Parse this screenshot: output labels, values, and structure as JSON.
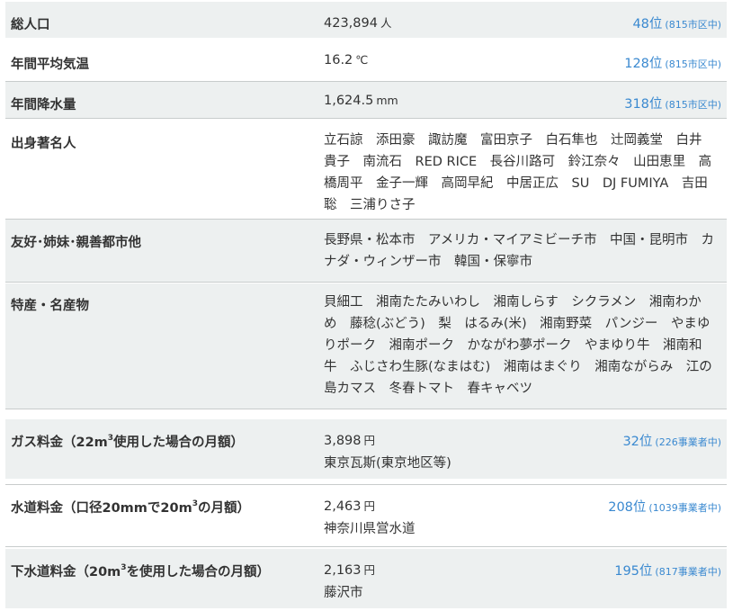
{
  "rows": {
    "population": {
      "label": "総人口",
      "value": "423,894",
      "unit": "人",
      "rank": "48位",
      "of": "(815市区中)"
    },
    "temperature": {
      "label": "年間平均気温",
      "value": "16.2",
      "unit": "℃",
      "rank": "128位",
      "of": "(815市区中)"
    },
    "rainfall": {
      "label": "年間降水量",
      "value": "1,624.5",
      "unit": "mm",
      "rank": "318位",
      "of": "(815市区中)"
    },
    "celebrities": {
      "label": "出身著名人",
      "text": "立石諒　添田豪　諏訪魔　富田京子　白石隼也　辻岡義堂　白井貴子　南流石　RED RICE　長谷川路可　鈴江奈々　山田恵里　高橋周平　金子一輝　高岡早紀　中居正広　SU　DJ FUMIYA　吉田聡　三浦りさ子"
    },
    "sister_cities": {
      "label": "友好･姉妹･親善都市他",
      "text": "長野県・松本市　アメリカ・マイアミビーチ市　中国・昆明市　カナダ・ウィンザー市　韓国・保寧市"
    },
    "specialties": {
      "label": "特産・名産物",
      "text": "貝細工　湘南たたみいわし　湘南しらす　シクラメン　湘南わかめ　藤稔(ぶどう)　梨　はるみ(米)　湘南野菜　パンジー　やまゆりポーク　湘南ポーク　かながわ夢ポーク　やまゆり牛　湘南和牛　ふじさわ生豚(なまはむ)　湘南はまぐり　湘南ながらみ　江の島カマス　冬春トマト　春キャベツ"
    },
    "gas": {
      "label_a": "ガス料金（22m",
      "label_sup": "3",
      "label_b": "使用した場合の月額）",
      "value": "3,898",
      "unit": "円",
      "provider": "東京瓦斯(東京地区等)",
      "rank": "32位",
      "of": "(226事業者中)"
    },
    "water": {
      "label_a": "水道料金（口径20mmで20m",
      "label_sup": "3",
      "label_b": "の月額）",
      "value": "2,463",
      "unit": "円",
      "provider": "神奈川県営水道",
      "rank": "208位",
      "of": "(1039事業者中)"
    },
    "sewer": {
      "label_a": "下水道料金（20m",
      "label_sup": "3",
      "label_b": "を使用した場合の月額）",
      "value": "2,163",
      "unit": "円",
      "provider": "藤沢市",
      "rank": "195位",
      "of": "(817事業者中)"
    }
  }
}
